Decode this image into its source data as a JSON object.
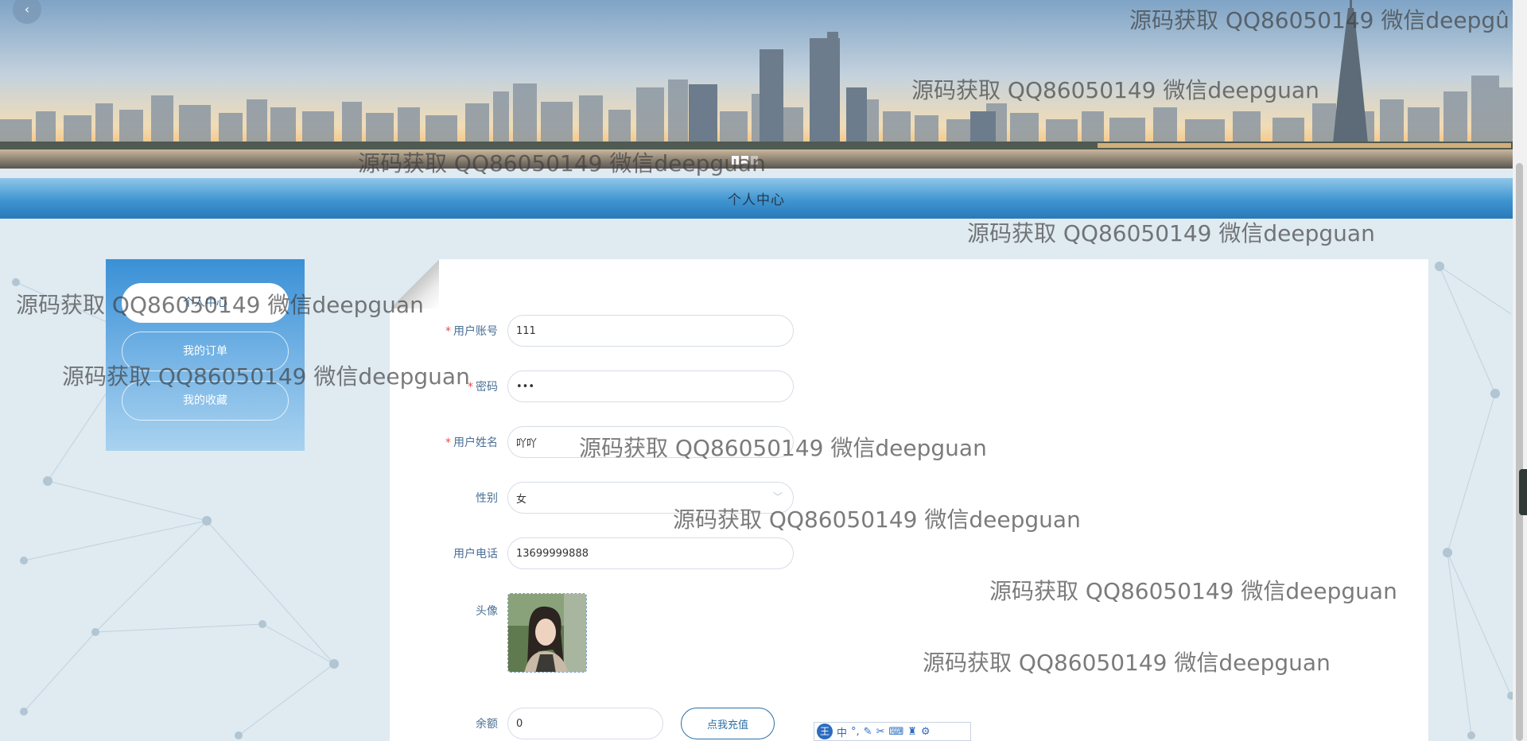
{
  "banner": {
    "back_label": "‹",
    "slide_indicators": [
      "on",
      "on",
      "off"
    ]
  },
  "page_title": "个人中心",
  "side_menu": {
    "items": [
      {
        "label": "个人中心",
        "active": true
      },
      {
        "label": "我的订单",
        "active": false
      },
      {
        "label": "我的收藏",
        "active": false
      }
    ]
  },
  "form": {
    "account": {
      "label": "用户账号",
      "required": true,
      "value": "111"
    },
    "password": {
      "label": "密码",
      "required": true,
      "value": "111"
    },
    "name": {
      "label": "用户姓名",
      "required": true,
      "value": "吖吖"
    },
    "gender": {
      "label": "性别",
      "value": "女"
    },
    "phone": {
      "label": "用户电话",
      "value": "13699999888"
    },
    "avatar": {
      "label": "头像"
    },
    "balance": {
      "label": "余额",
      "value": "0"
    },
    "recharge_button": "点我充值"
  },
  "ime_toolbar": {
    "logo": "王",
    "mode": "中",
    "icons": [
      "punctuation-icon",
      "pen-icon",
      "scissors-icon",
      "keyboard-icon",
      "skin-icon",
      "settings-icon"
    ]
  },
  "watermarks": [
    "源码获取 QQ86050149 微信deepgû",
    "源码获取 QQ86050149 微信deepguan",
    "源码获取 QQ86050149 微信deepguan",
    "源码获取 QQ86050149 微信deepguan",
    "源码获取 QQ86050149 微信deepguan",
    "源码获取 QQ86050149 微信deepguan",
    "源码获取 QQ86050149 微信deepguan",
    "源码获取 QQ86050149 微信deepguan",
    "源码获取 QQ86050149 微信deepguan",
    "源码获取 QQ86050149 微信deepguan"
  ],
  "colors": {
    "title_bar": "#3f95d1",
    "menu_gradient_top": "#3a90d6",
    "label": "#4a6f95",
    "required": "#e84b4b",
    "recharge_border": "#2c6fa6"
  }
}
